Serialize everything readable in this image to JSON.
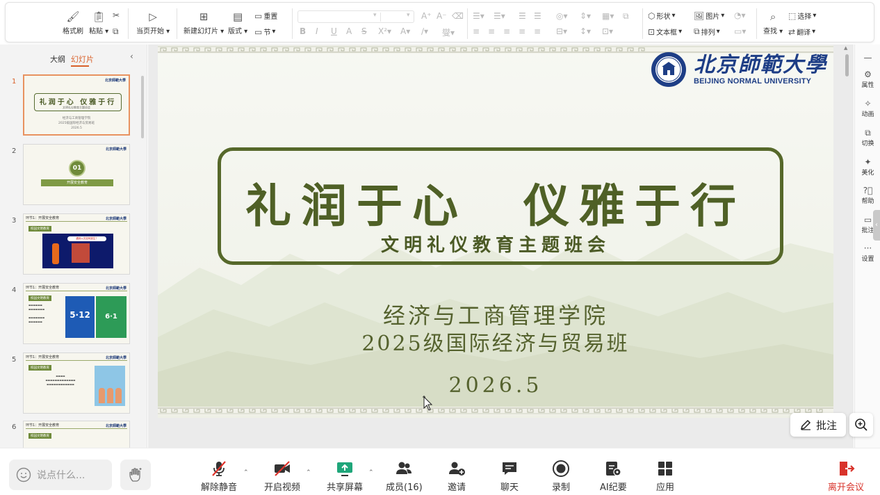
{
  "ribbon": {
    "format_brush": "格式刷",
    "paste": "粘贴",
    "from_current": "当页开始",
    "new_slide": "新建幻灯片",
    "layout": "版式",
    "reset": "重置",
    "section": "节",
    "shape": "形状",
    "picture": "图片",
    "textbox": "文本框",
    "arrange": "排列",
    "find": "查找",
    "select": "选择",
    "translate": "翻译"
  },
  "left_panel": {
    "tab_outline": "大纲",
    "tab_slides": "幻灯片",
    "thumbnails": [
      {
        "num": "1",
        "title": "礼润于心 仪雅于行",
        "sub": "文明礼仪教育主题班会",
        "line1": "经济与工商管理学院",
        "line2": "2025级国际经济与贸易班",
        "line3": "2026.5"
      },
      {
        "num": "2",
        "circle": "01",
        "bar": "开展安全教育"
      },
      {
        "num": "3",
        "head": "环节1：开展安全教育",
        "tag": "校园文明教育",
        "banner": "遇到火灾如何逃生？"
      },
      {
        "num": "4",
        "head": "环节1：开展安全教育",
        "tag": "校园文明教育",
        "blue": "5·12",
        "green": "6·1"
      },
      {
        "num": "5",
        "head": "环节1：开展安全教育",
        "tag": "校园文明教育"
      },
      {
        "num": "6",
        "head": "环节1：开展安全教育",
        "tag": "校园文明教育"
      }
    ]
  },
  "slide": {
    "logo_cn": "北京師範大學",
    "logo_en": "BEIJING NORMAL UNIVERSITY",
    "title": "礼润于心　仪雅于行",
    "subtitle": "文明礼仪教育主题班会",
    "college": "经济与工商管理学院",
    "class": "2025级国际经济与贸易班",
    "date": "2026.5"
  },
  "right_rail": {
    "properties": "属性",
    "animation": "动画",
    "transition": "切换",
    "beautify": "美化",
    "help": "帮助",
    "comment": "批注",
    "settings": "设置"
  },
  "annotate_label": "批注",
  "meeting_bar": {
    "chat_placeholder": "说点什么...",
    "unmute": "解除静音",
    "start_video": "开启视频",
    "share_screen": "共享屏幕",
    "members": "成员(16)",
    "invite": "邀请",
    "chat": "聊天",
    "record": "录制",
    "ai_minutes": "AI纪要",
    "apps": "应用",
    "leave": "离开会议"
  },
  "colors": {
    "accent_orange": "#d9612a",
    "title_green": "#4f6026",
    "logo_blue": "#1e3e86",
    "leave_red": "#d8332b",
    "share_green": "#1fa67a"
  }
}
